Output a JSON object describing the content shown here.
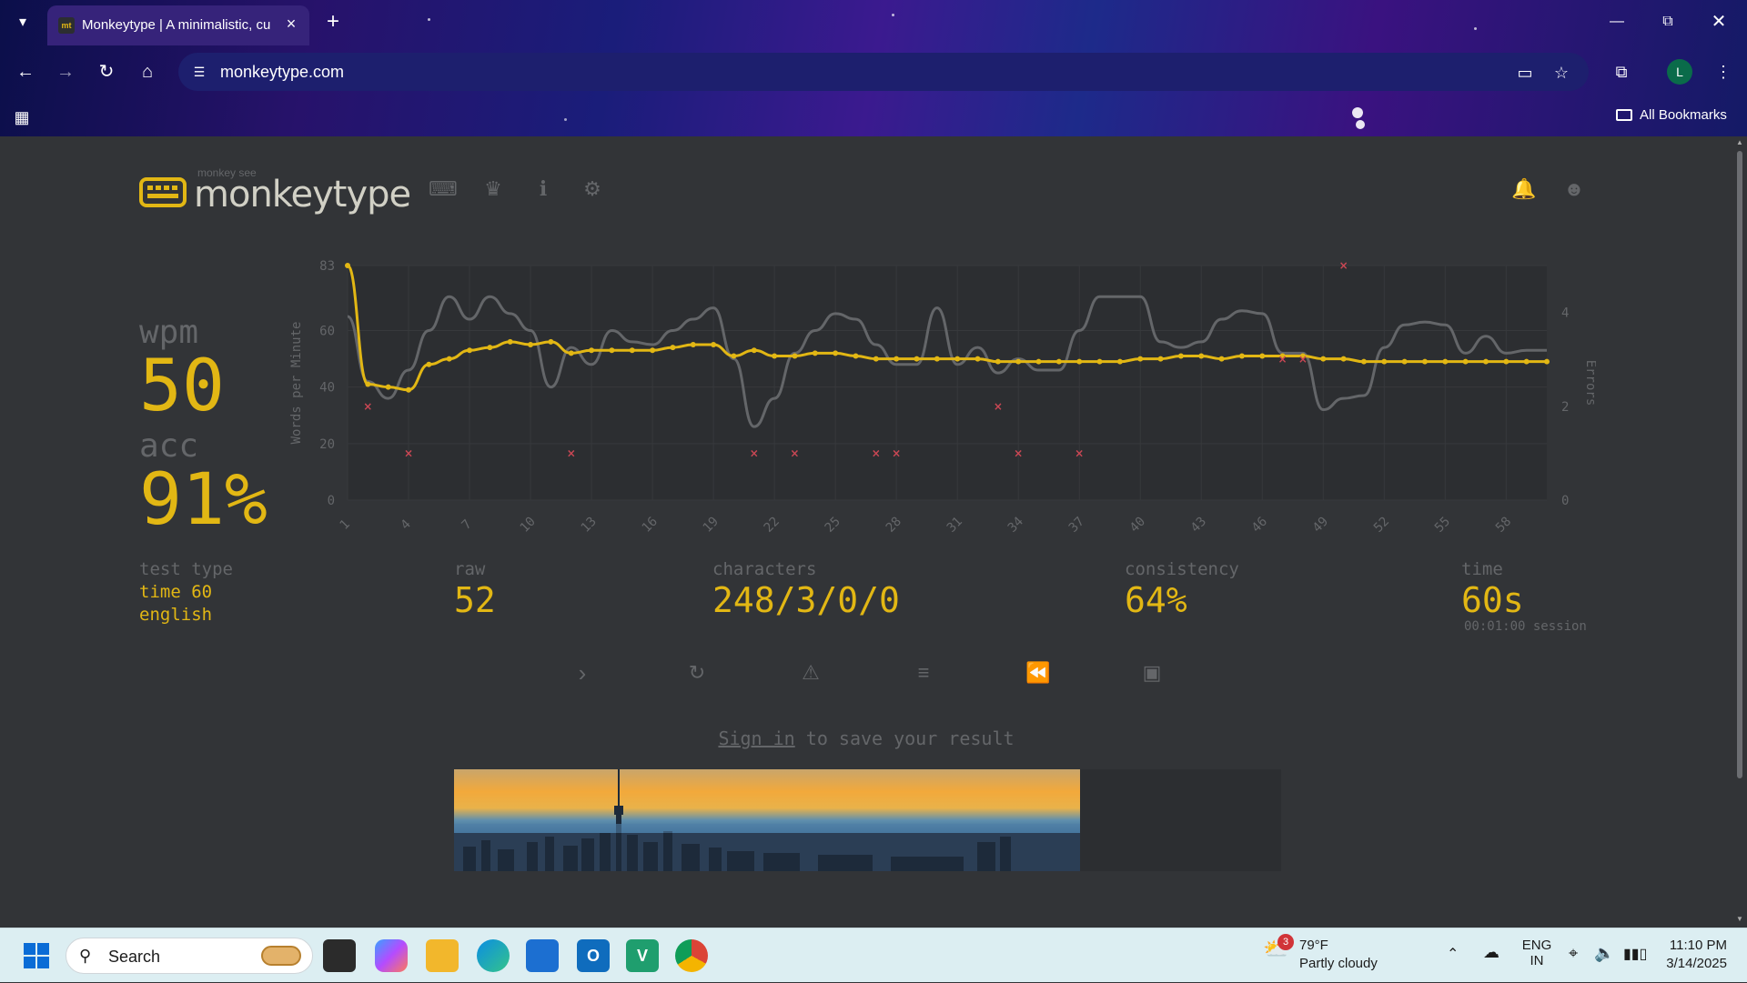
{
  "browser": {
    "tab_title": "Monkeytype | A minimalistic, cu",
    "favicon_text": "mt",
    "url": "monkeytype.com",
    "bookmarks_label": "All Bookmarks",
    "profile_initial": "L"
  },
  "site": {
    "logo_sub": "monkey see",
    "logo_name": "monkeytype"
  },
  "result": {
    "wpm_label": "wpm",
    "wpm_value": "50",
    "acc_label": "acc",
    "acc_value": "91%",
    "test_type_label": "test type",
    "test_type_line1": "time 60",
    "test_type_line2": "english",
    "raw_label": "raw",
    "raw_value": "52",
    "characters_label": "characters",
    "characters_value": "248/3/0/0",
    "consistency_label": "consistency",
    "consistency_value": "64%",
    "time_label": "time",
    "time_value": "60s",
    "session_text": "00:01:00 session"
  },
  "signin": {
    "link": "Sign in",
    "rest": " to save your result"
  },
  "taskbar": {
    "search_placeholder": "Search",
    "weather_temp": "79°F",
    "weather_desc": "Partly cloudy",
    "weather_badge": "3",
    "lang_line1": "ENG",
    "lang_line2": "IN",
    "time": "11:10 PM",
    "date": "3/14/2025"
  },
  "colors": {
    "accent": "#e2b714",
    "bg": "#323437",
    "sub": "#646669",
    "error": "#ca4754",
    "raw_line": "#646669"
  },
  "chart_data": {
    "type": "line",
    "ylabel": "Words per Minute",
    "y2label": "Errors",
    "ylim": [
      0,
      83
    ],
    "y2lim": [
      0,
      5
    ],
    "y_ticks": [
      0,
      20,
      40,
      60,
      83
    ],
    "y2_ticks": [
      0,
      2,
      4
    ],
    "x_ticks": [
      1,
      4,
      7,
      10,
      13,
      16,
      19,
      22,
      25,
      28,
      31,
      34,
      37,
      40,
      43,
      46,
      49,
      52,
      55,
      58
    ],
    "x": [
      1,
      2,
      3,
      4,
      5,
      6,
      7,
      8,
      9,
      10,
      11,
      12,
      13,
      14,
      15,
      16,
      17,
      18,
      19,
      20,
      21,
      22,
      23,
      24,
      25,
      26,
      27,
      28,
      29,
      30,
      31,
      32,
      33,
      34,
      35,
      36,
      37,
      38,
      39,
      40,
      41,
      42,
      43,
      44,
      45,
      46,
      47,
      48,
      49,
      50,
      51,
      52,
      53,
      54,
      55,
      56,
      57,
      58,
      59,
      60
    ],
    "series": [
      {
        "role": "wpm",
        "values": [
          83,
          41,
          40,
          39,
          48,
          50,
          53,
          54,
          56,
          55,
          56,
          52,
          53,
          53,
          53,
          53,
          54,
          55,
          55,
          51,
          53,
          51,
          51,
          52,
          52,
          51,
          50,
          50,
          50,
          50,
          50,
          50,
          49,
          49,
          49,
          49,
          49,
          49,
          49,
          50,
          50,
          51,
          51,
          50,
          51,
          51,
          51,
          51,
          50,
          50,
          49,
          49,
          49,
          49,
          49,
          49,
          49,
          49,
          49,
          49
        ]
      },
      {
        "role": "raw",
        "values": [
          65,
          42,
          36,
          46,
          60,
          72,
          64,
          72,
          66,
          60,
          40,
          54,
          48,
          60,
          56,
          55,
          60,
          64,
          68,
          50,
          26,
          36,
          52,
          60,
          66,
          64,
          55,
          48,
          48,
          68,
          48,
          54,
          45,
          50,
          46,
          46,
          60,
          72,
          72,
          72,
          56,
          54,
          56,
          64,
          67,
          66,
          52,
          52,
          32,
          36,
          37,
          54,
          62,
          63,
          62,
          52,
          58,
          52,
          53,
          53
        ]
      },
      {
        "role": "errors",
        "points": [
          [
            2,
            2
          ],
          [
            4,
            1
          ],
          [
            12,
            1
          ],
          [
            21,
            1
          ],
          [
            23,
            1
          ],
          [
            27,
            1
          ],
          [
            28,
            1
          ],
          [
            33,
            2
          ],
          [
            34,
            1
          ],
          [
            37,
            1
          ],
          [
            47,
            3
          ],
          [
            48,
            3
          ],
          [
            50,
            5
          ]
        ]
      }
    ]
  }
}
